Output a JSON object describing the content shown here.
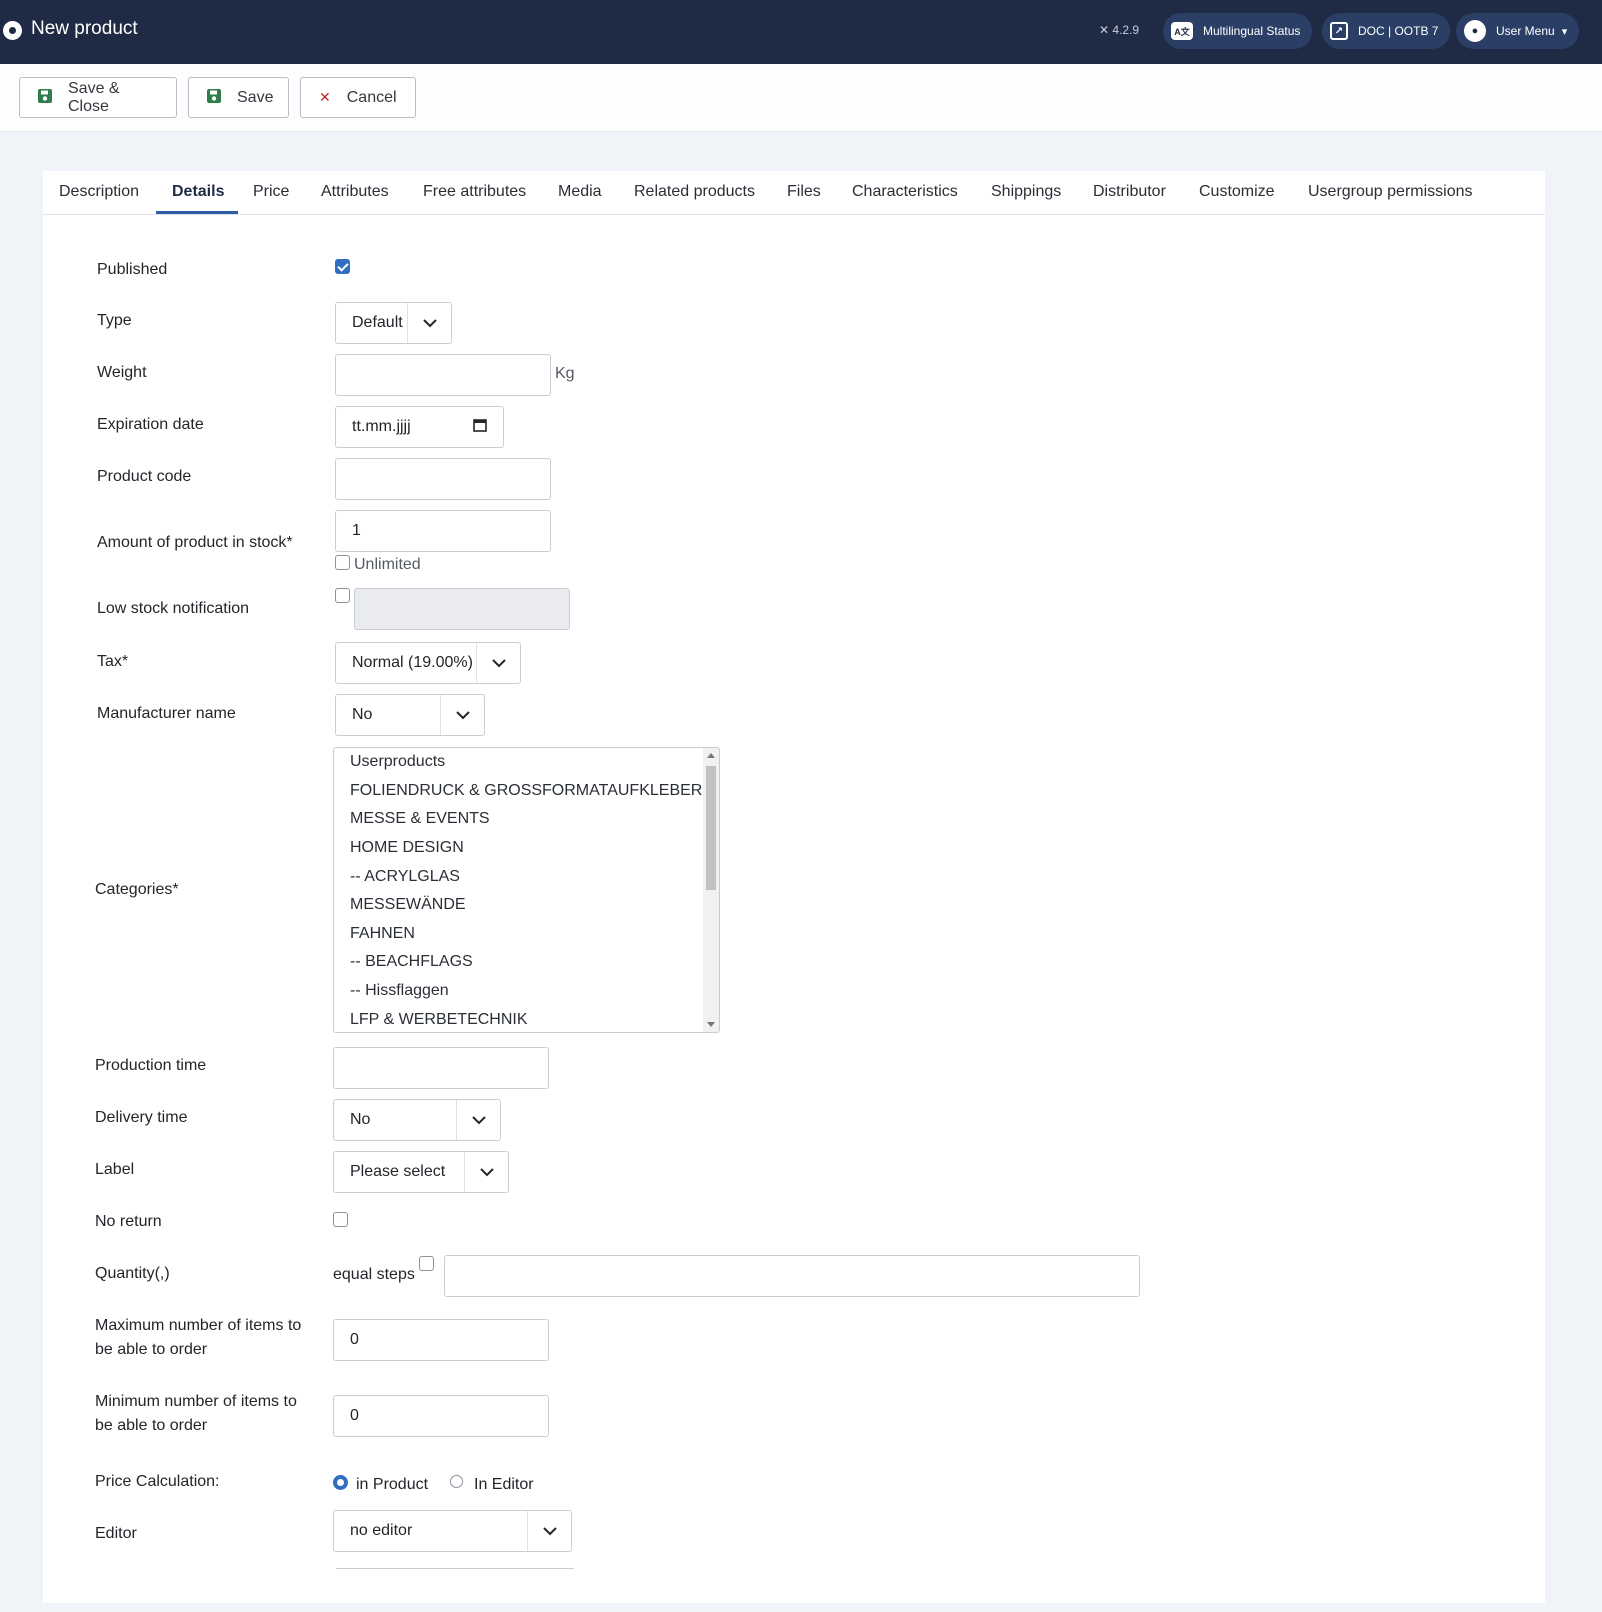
{
  "header": {
    "title": "New product",
    "version": "4.2.9",
    "multilingual_status": "Multilingual Status",
    "doc_link": "DOC | OOTB 7",
    "user_menu": "User Menu"
  },
  "toolbar": {
    "save_close_label": "Save & Close",
    "save_label": "Save",
    "cancel_label": "Cancel"
  },
  "tabs": [
    {
      "label": "Description"
    },
    {
      "label": "Details"
    },
    {
      "label": "Price"
    },
    {
      "label": "Attributes"
    },
    {
      "label": "Free attributes"
    },
    {
      "label": "Media"
    },
    {
      "label": "Related products"
    },
    {
      "label": "Files"
    },
    {
      "label": "Characteristics"
    },
    {
      "label": "Shippings"
    },
    {
      "label": "Distributor"
    },
    {
      "label": "Customize"
    },
    {
      "label": "Usergroup permissions"
    }
  ],
  "active_tab": "Details",
  "form": {
    "published": {
      "label": "Published",
      "checked": true
    },
    "type": {
      "label": "Type",
      "value": "Default"
    },
    "weight": {
      "label": "Weight",
      "value": "",
      "unit": "Kg"
    },
    "expiration_date": {
      "label": "Expiration date",
      "placeholder": "tt.mm.jjjj"
    },
    "product_code": {
      "label": "Product code",
      "value": ""
    },
    "stock": {
      "label": "Amount of product in stock*",
      "value": "1",
      "unlimited_label": "Unlimited"
    },
    "low_stock": {
      "label": "Low stock notification",
      "value": ""
    },
    "tax": {
      "label": "Tax*",
      "value": "Normal (19.00%)"
    },
    "manufacturer": {
      "label": "Manufacturer name",
      "value": "No"
    },
    "categories": {
      "label": "Categories*",
      "options": [
        "Userproducts",
        "FOLIENDRUCK & GROSSFORMATAUFKLEBER",
        "MESSE & EVENTS",
        "HOME DESIGN",
        "-- ACRYLGLAS",
        "MESSEWÄNDE",
        "FAHNEN",
        "-- BEACHFLAGS",
        "-- Hissflaggen",
        "LFP & WERBETECHNIK"
      ]
    },
    "production_time": {
      "label": "Production time",
      "value": ""
    },
    "delivery_time": {
      "label": "Delivery time",
      "value": "No"
    },
    "label_field": {
      "label": "Label",
      "value": "Please select"
    },
    "no_return": {
      "label": "No return",
      "checked": false
    },
    "quantity": {
      "label": "Quantity(,)",
      "equal_steps_label": "equal steps",
      "value": ""
    },
    "max_items": {
      "label_line1": "Maximum number of items to",
      "label_line2": "be able to order",
      "value": "0"
    },
    "min_items": {
      "label_line1": "Minimum number of items to",
      "label_line2": "be able to order",
      "value": "0"
    },
    "price_calc": {
      "label": "Price Calculation:",
      "option1": "in Product",
      "option2": "In Editor",
      "selected": "in Product"
    },
    "editor": {
      "label": "Editor",
      "value": "no editor"
    }
  },
  "colors": {
    "header_bg": "#1f2b45",
    "accent": "#2f6ec0",
    "save_icon": "#2f7d4a",
    "cancel_icon": "#c52827"
  }
}
